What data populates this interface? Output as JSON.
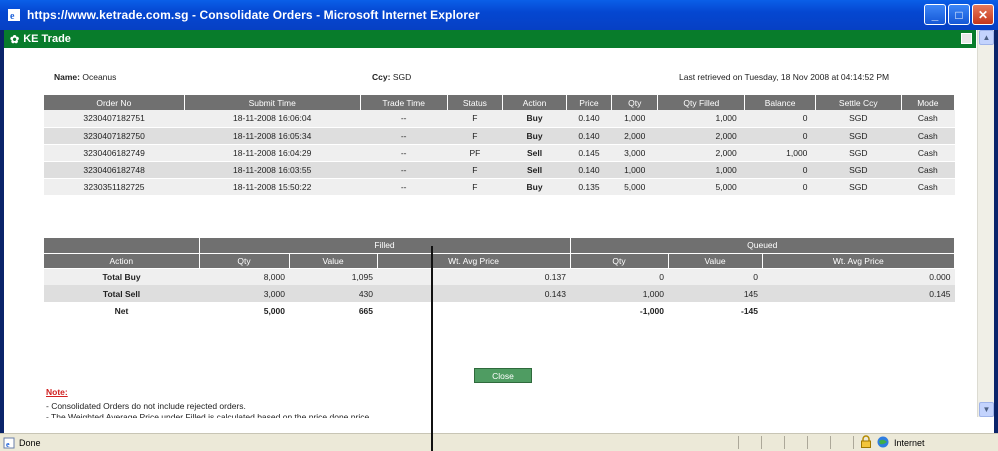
{
  "window": {
    "title": "https://www.ketrade.com.sg - Consolidate Orders - Microsoft Internet Explorer",
    "app_title": "KE Trade"
  },
  "info": {
    "name_label": "Name:",
    "name_value": "Oceanus",
    "ccy_label": "Ccy:",
    "ccy_value": "SGD",
    "last_retrieved": "Last retrieved on Tuesday, 18 Nov 2008 at 04:14:52 PM"
  },
  "orders": {
    "headers": [
      "Order No",
      "Submit Time",
      "Trade Time",
      "Status",
      "Action",
      "Price",
      "Qty",
      "Qty Filled",
      "Balance",
      "Settle Ccy",
      "Mode"
    ],
    "rows": [
      [
        "3230407182751",
        "18-11-2008 16:06:04",
        "--",
        "F",
        "Buy",
        "0.140",
        "1,000",
        "1,000",
        "0",
        "SGD",
        "Cash"
      ],
      [
        "3230407182750",
        "18-11-2008 16:05:34",
        "--",
        "F",
        "Buy",
        "0.140",
        "2,000",
        "2,000",
        "0",
        "SGD",
        "Cash"
      ],
      [
        "3230406182749",
        "18-11-2008 16:04:29",
        "--",
        "PF",
        "Sell",
        "0.145",
        "3,000",
        "2,000",
        "1,000",
        "SGD",
        "Cash"
      ],
      [
        "3230406182748",
        "18-11-2008 16:03:55",
        "--",
        "F",
        "Sell",
        "0.140",
        "1,000",
        "1,000",
        "0",
        "SGD",
        "Cash"
      ],
      [
        "3230351182725",
        "18-11-2008 15:50:22",
        "--",
        "F",
        "Buy",
        "0.135",
        "5,000",
        "5,000",
        "0",
        "SGD",
        "Cash"
      ]
    ]
  },
  "summary": {
    "filled_label": "Filled",
    "queued_label": "Queued",
    "headers": [
      "Action",
      "Qty",
      "Value",
      "Wt. Avg Price",
      "Qty",
      "Value",
      "Wt. Avg Price"
    ],
    "rows": [
      {
        "action": "Total Buy",
        "f_qty": "8,000",
        "f_value": "1,095",
        "f_avg": "0.137",
        "q_qty": "0",
        "q_value": "0",
        "q_avg": "0.000"
      },
      {
        "action": "Total Sell",
        "f_qty": "3,000",
        "f_value": "430",
        "f_avg": "0.143",
        "q_qty": "1,000",
        "q_value": "145",
        "q_avg": "0.145"
      },
      {
        "action": "Net",
        "f_qty": "5,000",
        "f_value": "665",
        "f_avg": "",
        "q_qty": "-1,000",
        "q_value": "-145",
        "q_avg": ""
      }
    ]
  },
  "close_label": "Close",
  "note": {
    "title": "Note:",
    "line1": "- Consolidated Orders do not include rejected orders.",
    "line2": "- The Weighted Average Price under Filled is calculated based on the price done price."
  },
  "statusbar": {
    "status": "Done",
    "zone": "Internet"
  },
  "colors": {
    "title_blue": "#0547d1",
    "app_green": "#087c2b",
    "header_gray": "#707070",
    "buy_green": "#2a9b43",
    "sell_red": "#d11f1f"
  }
}
